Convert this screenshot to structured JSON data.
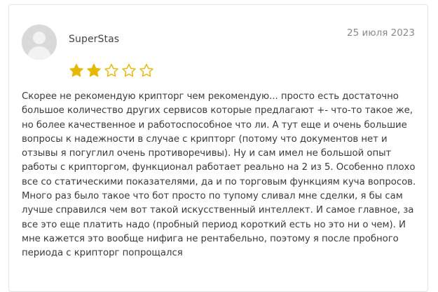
{
  "review": {
    "author": "SuperStas",
    "date": "25 июля 2023",
    "rating": 2,
    "rating_max": 5,
    "star_color": "#e6b800",
    "avatar_icon": "user-silhouette-icon",
    "text": "Скорее не рекомендую крипторг чем рекомендую... просто есть достаточно большое количество других сервисов которые предлагают +- что-то такое же, но более качественное и работоспособное что ли. А тут еще и очень большие вопросы к надежности в случае с крипторг (потому что документов нет и отзывы я погуглил очень противоречивы). Ну и сам имел не большой опыт работы с крипторгом, функционал работает реально на 2 из 5. Особенно плохо все со статическими показателями, да и по торговым функциям куча вопросов. Много раз было такое что бот просто по тупому сливал мне сделки, я бы сам лучше справился чем вот такой искусственный интеллект. И самое главное, за все это еще платить надо (пробный период короткий есть но это ни о чем). И мне кажется это вообще нифига не рентабельно, поэтому я после пробного периода с крипторг попрощался"
  }
}
